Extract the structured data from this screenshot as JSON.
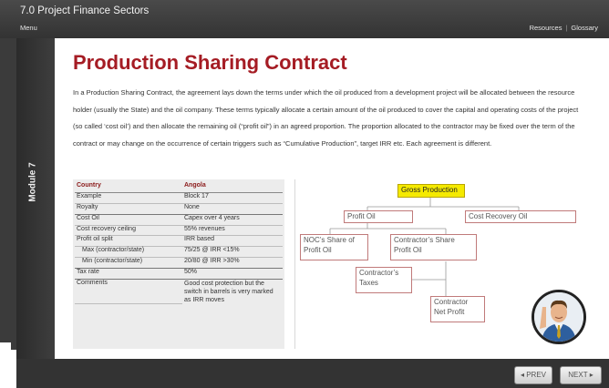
{
  "header": {
    "course_title": "7.0  Project Finance Sectors",
    "menu_label": "Menu",
    "resources_label": "Resources",
    "glossary_label": "Glossary"
  },
  "sidebar": {
    "module_label": "Module 7"
  },
  "main": {
    "title": "Production Sharing Contract",
    "intro": "In a Production Sharing Contract, the agreement lays down the terms under which the oil produced from a development project will be allocated between the resource holder (usually the State) and the oil company. These terms typically allocate a certain amount of the oil produced to cover  the capital and operating costs of the project (so called ‘cost oil’) and then allocate the remaining oil (“profit oil”) in an agreed proportion. The proportion allocated to the contractor may be fixed over the term of the contract or may change on the occurrence of certain triggers such as “Cumulative Production”, target IRR etc. Each agreement is different."
  },
  "table": {
    "headers": [
      "Country",
      "Angola"
    ],
    "rows": [
      [
        "Example",
        "Block 17"
      ],
      [
        "Royalty",
        "None"
      ],
      [
        "Cost Oil",
        "Capex over 4 years"
      ],
      [
        "Cost recovery ceiling",
        "55% revenues"
      ],
      [
        "Profit oil split",
        "IRR based"
      ],
      [
        "Max (contractor/state)",
        "75/25 @ IRR <15%"
      ],
      [
        "Min (contractor/state)",
        "20/80 @ IRR >30%"
      ],
      [
        "Tax rate",
        "50%"
      ],
      [
        "Comments",
        "Good cost protection but the switch in barrels is very marked as IRR moves"
      ]
    ]
  },
  "diagram": {
    "gross": "Gross Production",
    "profit_oil": "Profit Oil",
    "cost_recovery_oil": "Cost Recovery Oil",
    "noc_share": "NOC’s Share of Profit Oil",
    "contractor_share": "Contractor’s Share Profit Oil",
    "contractor_taxes": "Contractor’s Taxes",
    "contractor_net": "Contractor Net Profit"
  },
  "footer": {
    "prev_label": "◂ PREV",
    "next_label": "NEXT ▸"
  }
}
